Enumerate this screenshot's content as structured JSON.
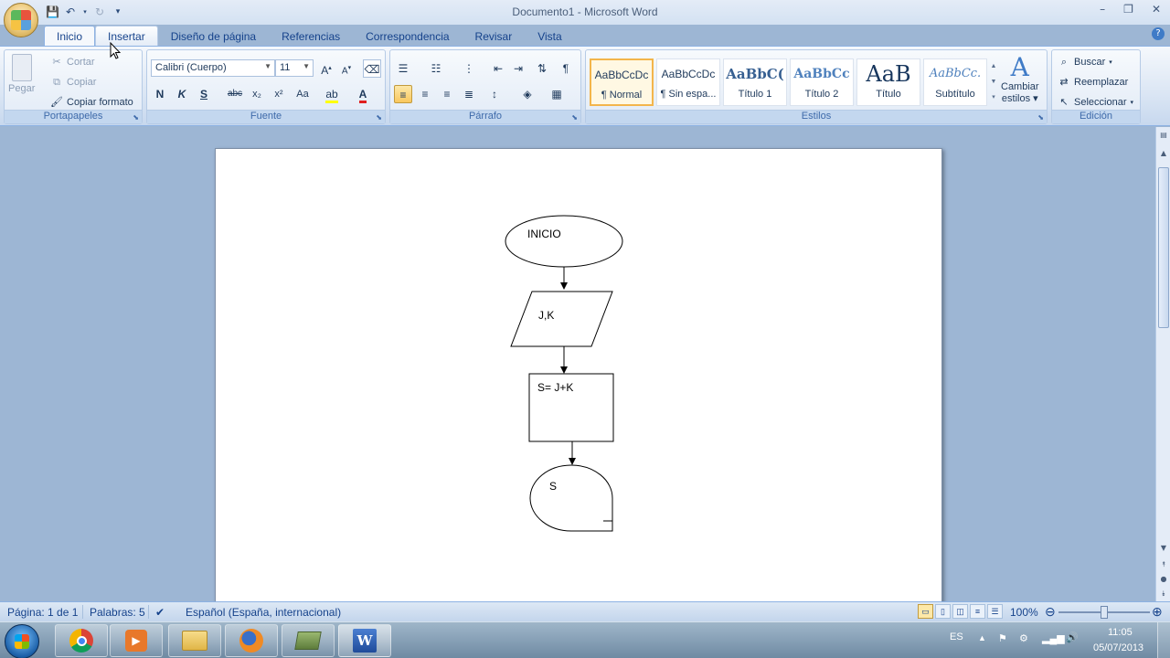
{
  "window": {
    "title": "Documento1 - Microsoft Word"
  },
  "tabs": [
    {
      "label": "Inicio"
    },
    {
      "label": "Insertar"
    },
    {
      "label": "Diseño de página"
    },
    {
      "label": "Referencias"
    },
    {
      "label": "Correspondencia"
    },
    {
      "label": "Revisar"
    },
    {
      "label": "Vista"
    }
  ],
  "ribbon": {
    "clipboard": {
      "label": "Portapapeles",
      "paste": "Pegar",
      "cut": "Cortar",
      "copy": "Copiar",
      "format_painter": "Copiar formato"
    },
    "font": {
      "label": "Fuente",
      "family": "Calibri (Cuerpo)",
      "size": "11",
      "bold": "N",
      "italic": "K",
      "underline": "S",
      "strike": "abc",
      "sub": "x₂",
      "sup": "x²",
      "case": "Aa"
    },
    "paragraph": {
      "label": "Párrafo"
    },
    "styles": {
      "label": "Estilos",
      "items": [
        {
          "sample": "AaBbCcDc",
          "name": "¶ Normal"
        },
        {
          "sample": "AaBbCcDc",
          "name": "¶ Sin espa..."
        },
        {
          "sample": "AaBbC(",
          "name": "Título 1"
        },
        {
          "sample": "AaBbCc",
          "name": "Título 2"
        },
        {
          "sample": "AaB",
          "name": "Título"
        },
        {
          "sample": "AaBbCc.",
          "name": "Subtítulo"
        }
      ],
      "change_styles_1": "Cambiar",
      "change_styles_2": "estilos"
    },
    "editing": {
      "label": "Edición",
      "find": "Buscar",
      "replace": "Reemplazar",
      "select": "Seleccionar"
    }
  },
  "flowchart": {
    "start": "INICIO",
    "input": "J,K",
    "process": "S= J+K",
    "output": "S"
  },
  "status": {
    "page": "Página: 1 de 1",
    "words": "Palabras: 5",
    "language": "Español (España, internacional)",
    "zoom": "100%"
  },
  "taskbar": {
    "lang": "ES",
    "time": "11:05",
    "date": "05/07/2013"
  }
}
